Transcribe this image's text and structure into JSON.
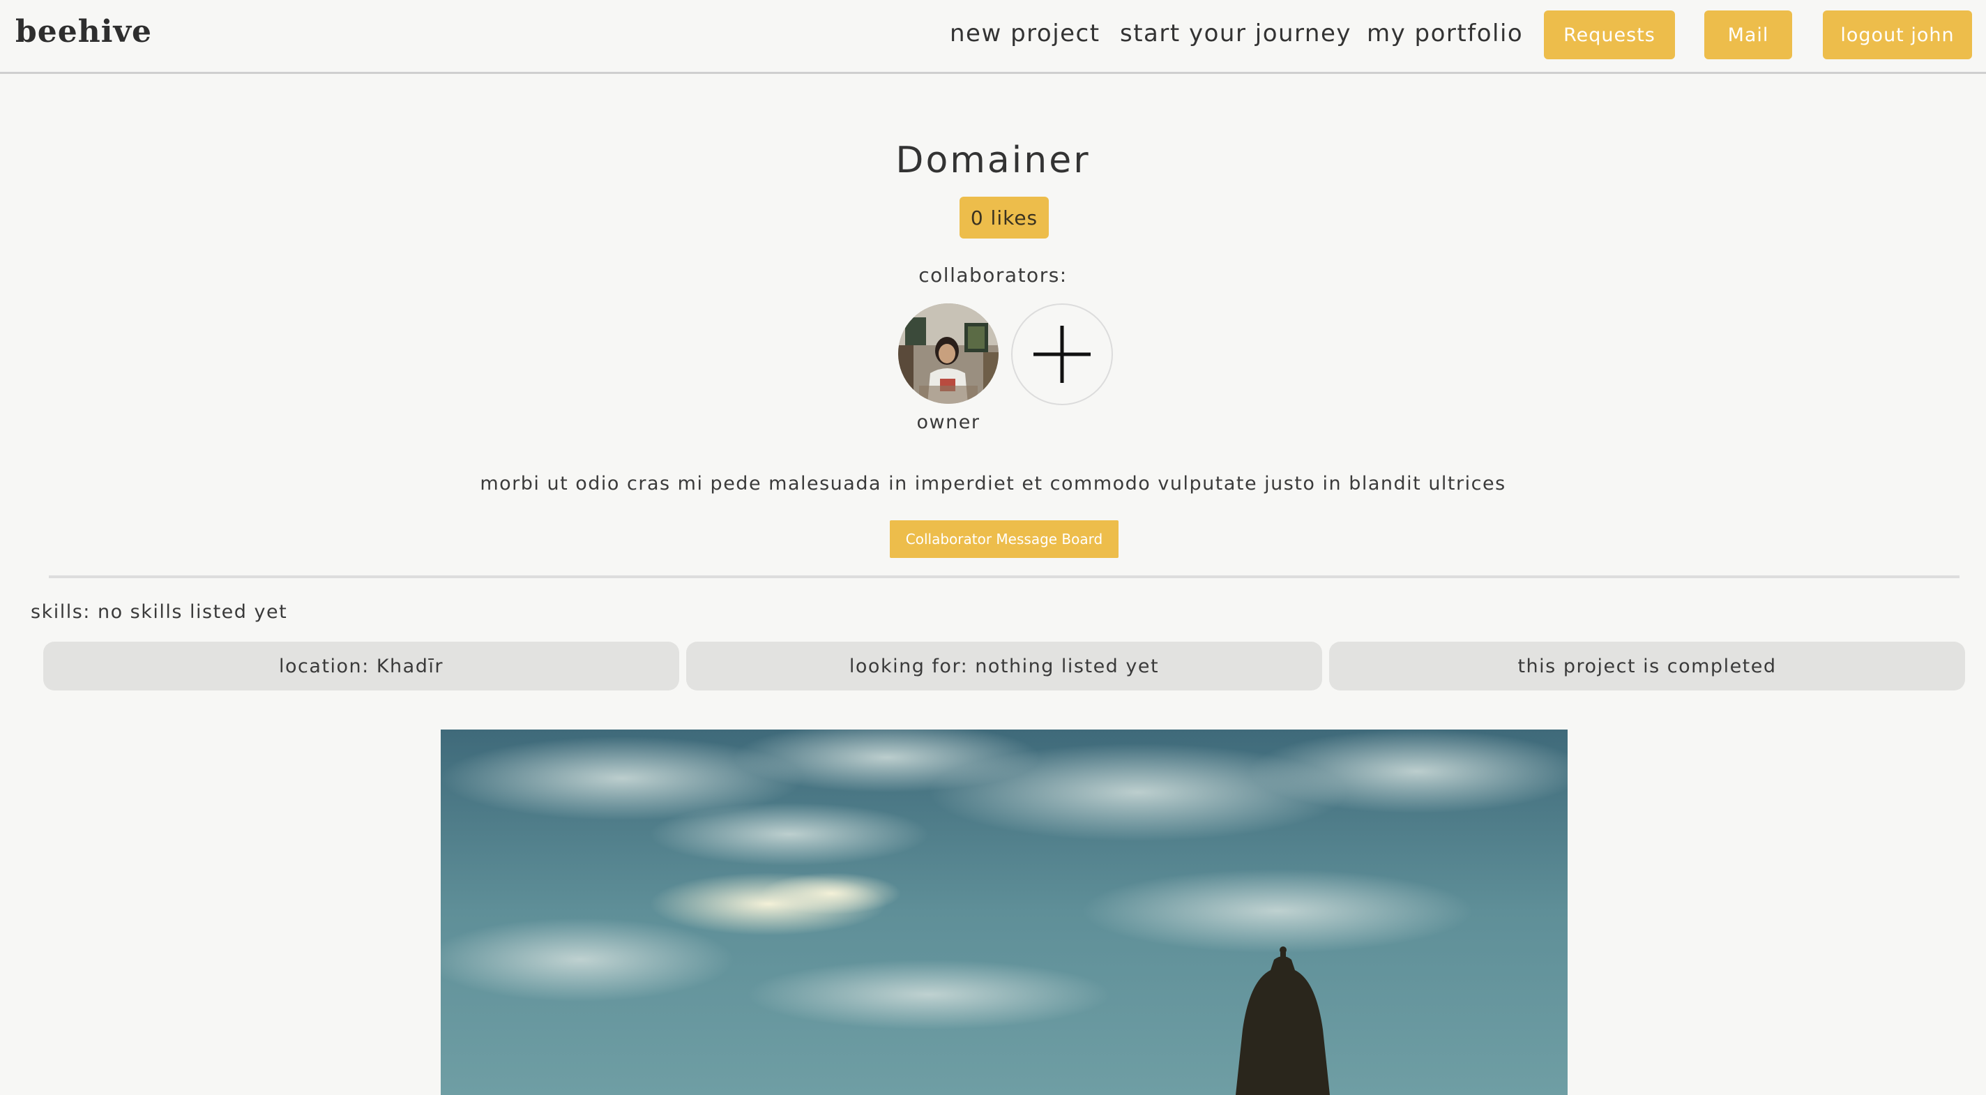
{
  "header": {
    "logo": "beehive",
    "nav": {
      "new_project": "new project",
      "start_journey": "start your journey",
      "portfolio": "my portfolio"
    },
    "buttons": {
      "requests": "Requests",
      "mail": "Mail",
      "logout": "logout john"
    }
  },
  "project": {
    "title": "Domainer",
    "likes": "0 likes",
    "collaborators_label": "collaborators:",
    "owner_label": "owner",
    "description": "morbi ut odio cras mi pede malesuada in imperdiet et commodo vulputate justo in blandit ultrices",
    "message_board_button": "Collaborator Message Board",
    "skills": "skills: no skills listed yet",
    "location": "location: Khadīr",
    "looking_for": "looking for: nothing listed yet",
    "status": "this project is completed"
  },
  "colors": {
    "accent": "#edbd4b",
    "background": "#f7f7f5",
    "pill": "#e2e2e0",
    "text": "#3a3a3a"
  }
}
